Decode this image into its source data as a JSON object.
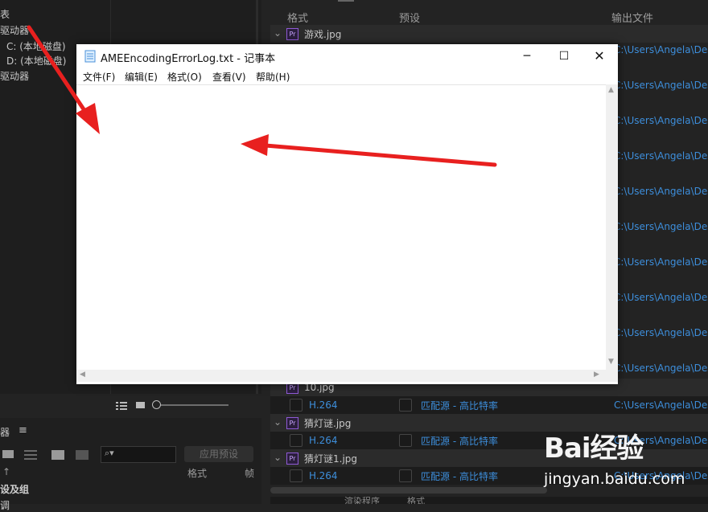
{
  "left_tree": {
    "items": [
      "表",
      "驱动器",
      "C: (本地磁盘)",
      "D: (本地磁盘)",
      "驱动器"
    ]
  },
  "presets": {
    "title": "器",
    "apply_label": "应用预设",
    "col_format": "格式",
    "col_frame": "帧",
    "group_label": "设及组",
    "sub_label": "调"
  },
  "queue": {
    "headers": {
      "format": "格式",
      "preset": "预设",
      "output": "输出文件"
    },
    "output_path": "C:\\Users\\Angela\\Desk",
    "groups": [
      {
        "name": "游戏.jpg"
      },
      {
        "name": "10.jpg"
      },
      {
        "name": "猜灯谜.jpg"
      },
      {
        "name": "猜灯谜1.jpg"
      }
    ],
    "item_format": "H.264",
    "item_preset": "匹配源 - 高比特率"
  },
  "notepad": {
    "title": "AMEEncodingErrorLog.txt - 记事本",
    "menus": [
      "文件(F)",
      "编辑(E)",
      "格式(O)",
      "查看(V)",
      "帮助(H)"
    ],
    "content": ""
  },
  "bottom_bar": {
    "left_label": "渲染程序",
    "mid_label": "格式"
  },
  "watermark": {
    "brand": "Bai经验",
    "url": "jingyan.baidu.com"
  },
  "colors": {
    "accent_blue": "#3d8edb",
    "annotation_red": "#e8201f",
    "premiere_purple": "#8f5ad6"
  }
}
